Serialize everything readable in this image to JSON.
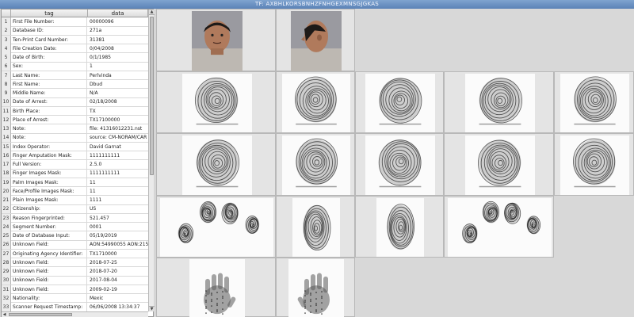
{
  "window": {
    "title": "TF: AXBHLKORSBNHZFNHGEXMNSGJGKAS"
  },
  "table": {
    "headers": {
      "tag": "tag",
      "data": "data"
    },
    "rows": [
      {
        "n": "1",
        "tag": "First File Number:",
        "val": "00000096"
      },
      {
        "n": "2",
        "tag": "Database ID:",
        "val": "271a"
      },
      {
        "n": "3",
        "tag": "Ten-Print Card Number:",
        "val": "31381"
      },
      {
        "n": "4",
        "tag": "File Creation Date:",
        "val": "0/04/2008"
      },
      {
        "n": "5",
        "tag": "Date of Birth:",
        "val": "0/1/1985"
      },
      {
        "n": "6",
        "tag": "Sex:",
        "val": "1"
      },
      {
        "n": "7",
        "tag": "Last Name:",
        "val": "Perlvinda"
      },
      {
        "n": "8",
        "tag": "First Name:",
        "val": "Dbud"
      },
      {
        "n": "9",
        "tag": "Middle Name:",
        "val": "N/A"
      },
      {
        "n": "10",
        "tag": "Date of Arrest:",
        "val": "02/18/2008"
      },
      {
        "n": "11",
        "tag": "Birth Place:",
        "val": "TX"
      },
      {
        "n": "12",
        "tag": "Place of Arrest:",
        "val": "TX17100000"
      },
      {
        "n": "13",
        "tag": "Note:",
        "val": "file: 41316012231.nst"
      },
      {
        "n": "14",
        "tag": "Note:",
        "val": "source: CM-NORAM/CAR"
      },
      {
        "n": "15",
        "tag": "Index Operator:",
        "val": "David Garnat"
      },
      {
        "n": "16",
        "tag": "Finger Amputation Mask:",
        "val": "1111111111"
      },
      {
        "n": "17",
        "tag": "Full Version:",
        "val": "2.5.0"
      },
      {
        "n": "18",
        "tag": "Finger Images Mask:",
        "val": "1111111111"
      },
      {
        "n": "19",
        "tag": "Palm Images Mask:",
        "val": "11"
      },
      {
        "n": "20",
        "tag": "Face/Profile Images Mask:",
        "val": "11"
      },
      {
        "n": "21",
        "tag": "Plain Images Mask:",
        "val": "1111"
      },
      {
        "n": "22",
        "tag": "Citizenship:",
        "val": "US"
      },
      {
        "n": "23",
        "tag": "Reason Fingerprinted:",
        "val": "521.457"
      },
      {
        "n": "24",
        "tag": "Segment Number:",
        "val": "0001"
      },
      {
        "n": "25",
        "tag": "Date of Database Input:",
        "val": "05/19/2019"
      },
      {
        "n": "26",
        "tag": "Unknown Field:",
        "val": "AON:54990055 AON:215"
      },
      {
        "n": "27",
        "tag": "Originating Agency Identifier:",
        "val": "TX1710000"
      },
      {
        "n": "28",
        "tag": "Unknown Field:",
        "val": "2018-07-25"
      },
      {
        "n": "29",
        "tag": "Unknown Field:",
        "val": "2018-07-20"
      },
      {
        "n": "30",
        "tag": "Unknown Field:",
        "val": "2017-08-04"
      },
      {
        "n": "31",
        "tag": "Unknown Field:",
        "val": "2009-02-19"
      },
      {
        "n": "32",
        "tag": "Nationality:",
        "val": "Mexic"
      },
      {
        "n": "33",
        "tag": "Scanner Request Timestamp:",
        "val": "06/06/2008 13:34:37"
      }
    ]
  },
  "images": {
    "mugshots": [
      "face-front-photo",
      "face-profile-photo"
    ],
    "rolled_fingers": 10,
    "plain_impressions": 4,
    "palms": 2
  },
  "colors": {
    "titlebar": "#6a8fc3",
    "panel_bg": "#ffffff",
    "grid_bg": "#d8d8d8",
    "ink": "#2a2a2a"
  }
}
